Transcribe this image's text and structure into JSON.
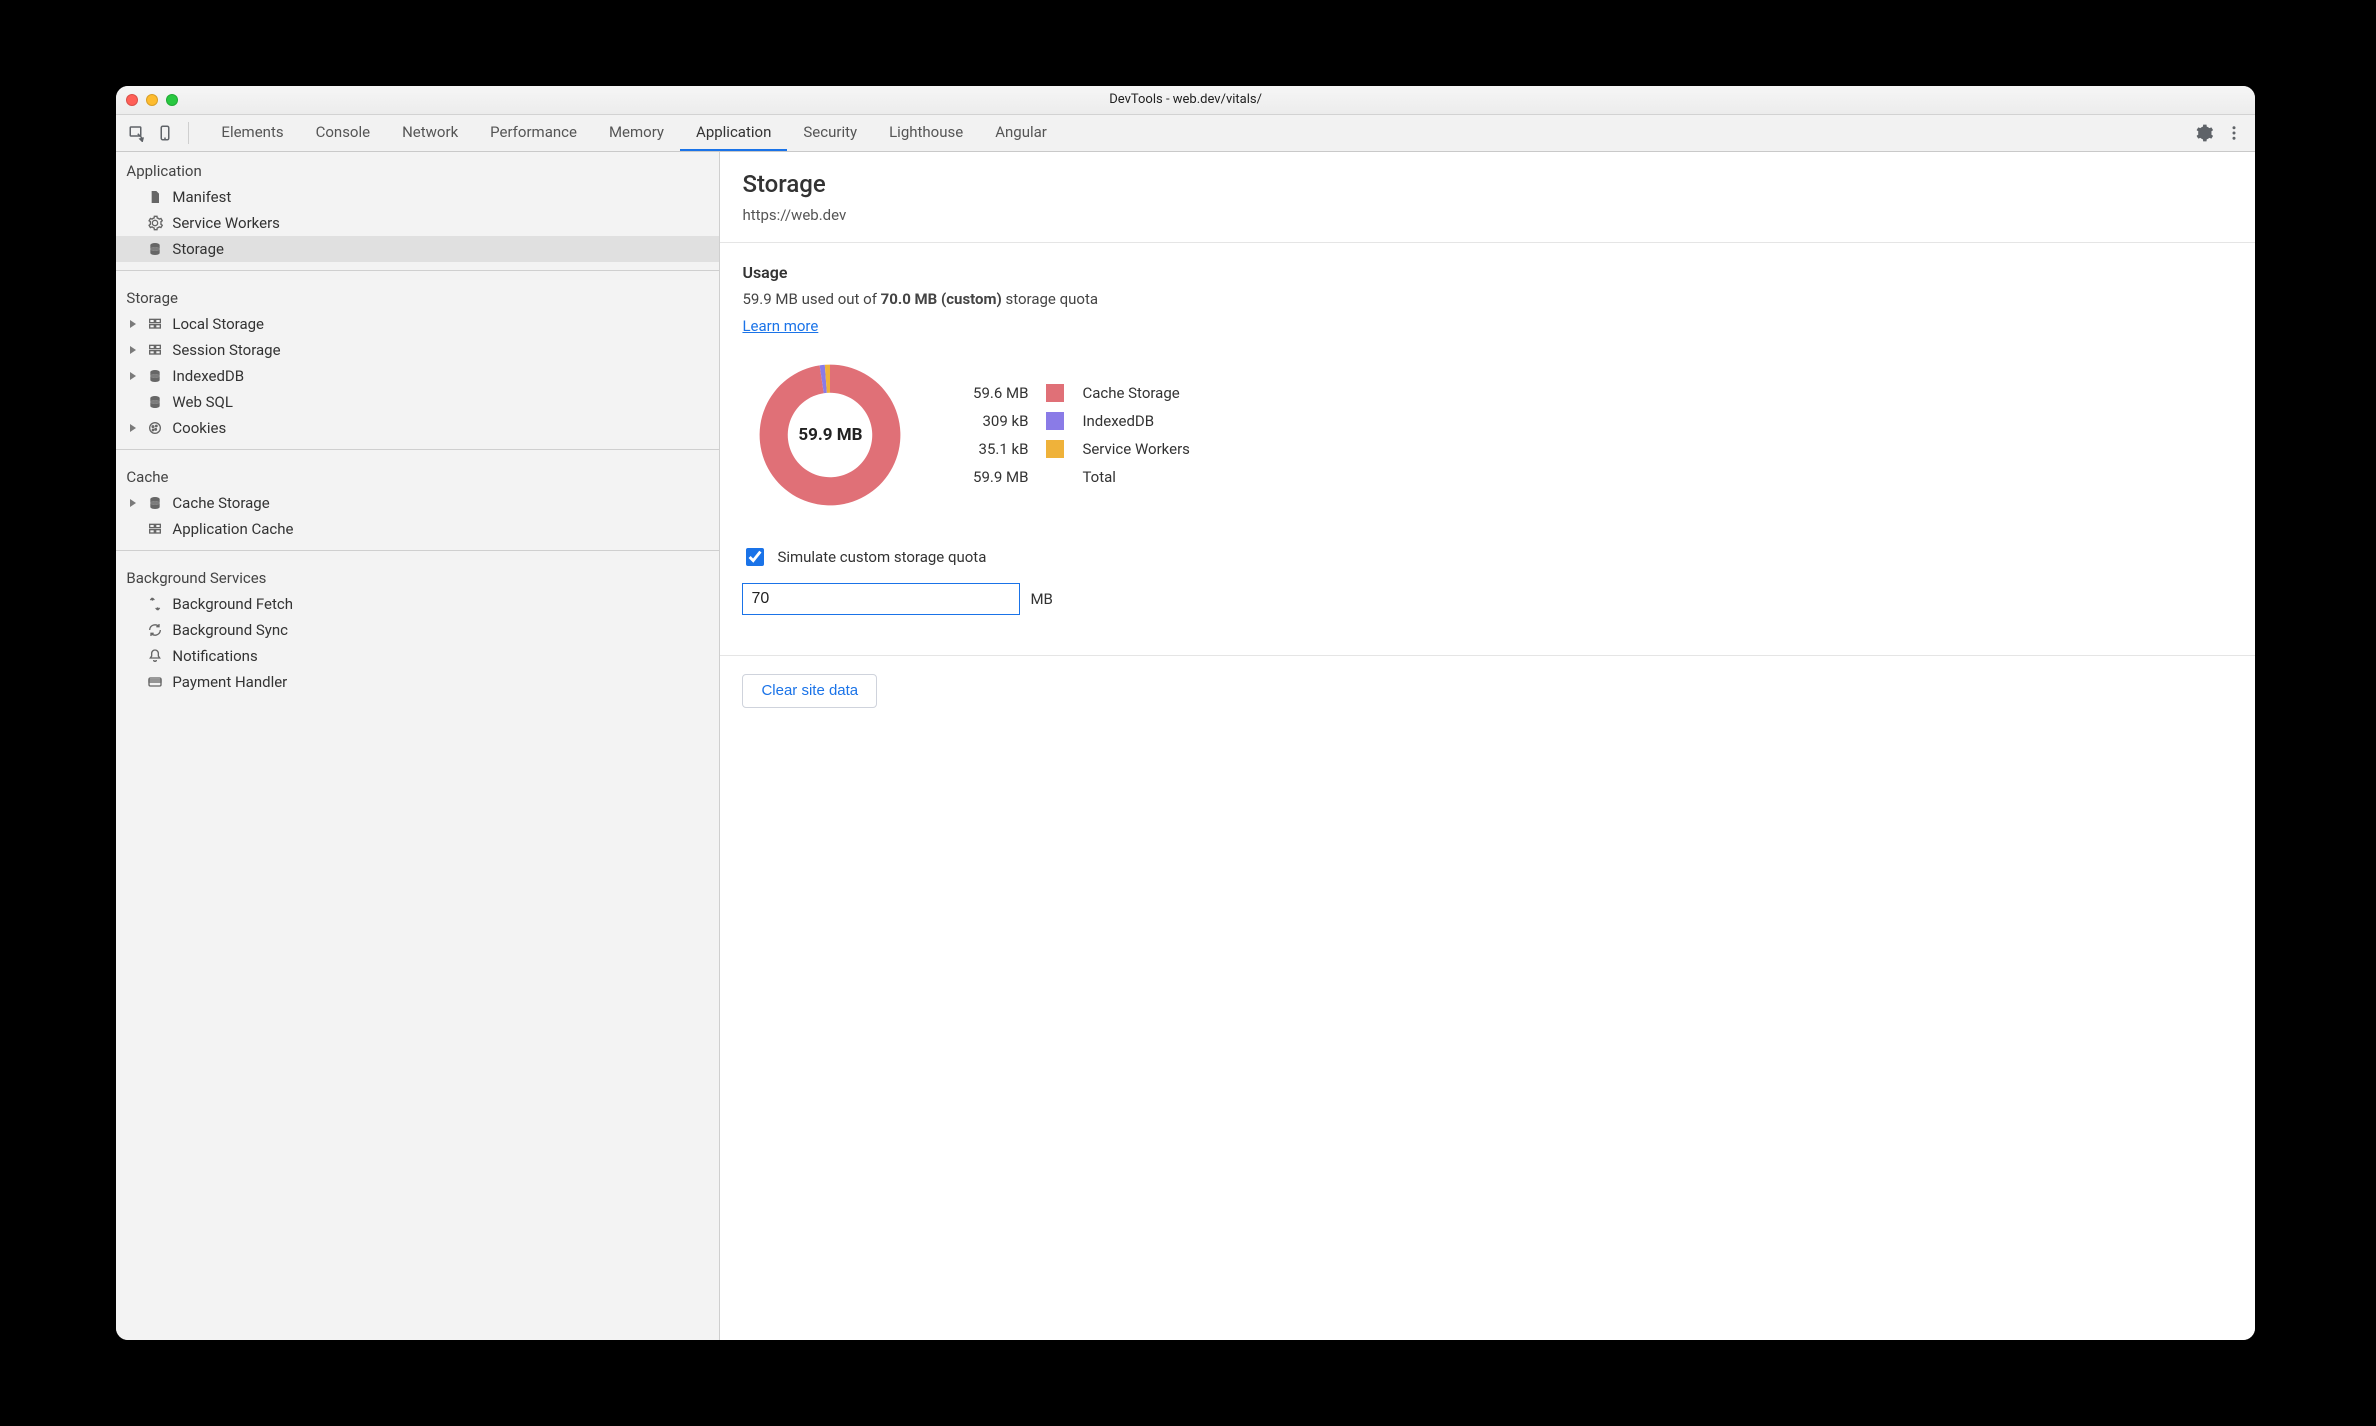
{
  "window": {
    "title": "DevTools - web.dev/vitals/"
  },
  "tabs": {
    "items": [
      "Elements",
      "Console",
      "Network",
      "Performance",
      "Memory",
      "Application",
      "Security",
      "Lighthouse",
      "Angular"
    ],
    "active_index": 5
  },
  "sidebar": {
    "sections": [
      {
        "title": "Application",
        "items": [
          {
            "label": "Manifest",
            "icon": "file-icon",
            "expandable": false
          },
          {
            "label": "Service Workers",
            "icon": "gear-icon",
            "expandable": false
          },
          {
            "label": "Storage",
            "icon": "database-icon",
            "expandable": false,
            "selected": true
          }
        ]
      },
      {
        "title": "Storage",
        "items": [
          {
            "label": "Local Storage",
            "icon": "grid-icon",
            "expandable": true
          },
          {
            "label": "Session Storage",
            "icon": "grid-icon",
            "expandable": true
          },
          {
            "label": "IndexedDB",
            "icon": "database-icon",
            "expandable": true
          },
          {
            "label": "Web SQL",
            "icon": "database-icon",
            "expandable": false
          },
          {
            "label": "Cookies",
            "icon": "cookie-icon",
            "expandable": true
          }
        ]
      },
      {
        "title": "Cache",
        "items": [
          {
            "label": "Cache Storage",
            "icon": "database-icon",
            "expandable": true
          },
          {
            "label": "Application Cache",
            "icon": "grid-icon",
            "expandable": false
          }
        ]
      },
      {
        "title": "Background Services",
        "items": [
          {
            "label": "Background Fetch",
            "icon": "transfer-icon",
            "expandable": false
          },
          {
            "label": "Background Sync",
            "icon": "sync-icon",
            "expandable": false
          },
          {
            "label": "Notifications",
            "icon": "bell-icon",
            "expandable": false
          },
          {
            "label": "Payment Handler",
            "icon": "card-icon",
            "expandable": false
          }
        ]
      }
    ]
  },
  "panel": {
    "title": "Storage",
    "origin": "https://web.dev",
    "usage_title": "Usage",
    "usage_line_prefix": "59.9 MB used out of ",
    "usage_line_bold": "70.0 MB (custom)",
    "usage_line_suffix": " storage quota",
    "learn_more": "Learn more",
    "donut_center": "59.9 MB",
    "legend": [
      {
        "size": "59.6 MB",
        "name": "Cache Storage",
        "color": "#e07077"
      },
      {
        "size": "309 kB",
        "name": "IndexedDB",
        "color": "#8a7be7"
      },
      {
        "size": "35.1 kB",
        "name": "Service Workers",
        "color": "#efb23a"
      }
    ],
    "legend_total": {
      "size": "59.9 MB",
      "name": "Total"
    },
    "simulate_label": "Simulate custom storage quota",
    "simulate_checked": true,
    "quota_value": "70",
    "quota_unit": "MB",
    "clear_label": "Clear site data"
  },
  "chart_data": {
    "type": "pie",
    "title": "Storage usage",
    "categories": [
      "Cache Storage",
      "IndexedDB",
      "Service Workers"
    ],
    "values_bytes": [
      59600000,
      309000,
      35100
    ],
    "series": [
      {
        "name": "Cache Storage",
        "color": "#e07077",
        "value": 59600000
      },
      {
        "name": "IndexedDB",
        "color": "#8a7be7",
        "value": 309000
      },
      {
        "name": "Service Workers",
        "color": "#efb23a",
        "value": 35100
      }
    ],
    "total_label": "59.9 MB",
    "quota_bytes": 70000000
  }
}
